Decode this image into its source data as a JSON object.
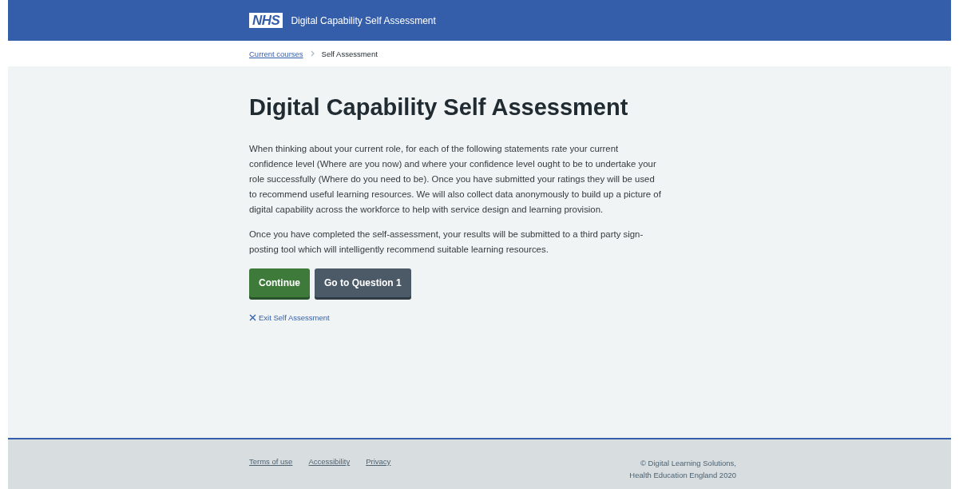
{
  "header": {
    "logo": "NHS",
    "title": "Digital Capability Self Assessment"
  },
  "breadcrumb": [
    {
      "label": "Current courses",
      "kind": "link"
    },
    {
      "label": "Self Assessment",
      "kind": "current"
    }
  ],
  "heading": "Digital Capability Self Assessment",
  "paragraphs": [
    "When thinking about your current role, for each of the following statements rate your current confidence level (Where are you now) and where your confidence level ought to be to undertake your role successfully (Where do you need to be). Once you have submitted your ratings they will be used to recommend useful learning resources. We will also collect data anonymously to build up a picture of digital capability across the workforce to help with service design and learning provision.",
    "Once you have completed the self-assessment, your results will be submitted to a third party sign-posting tool which will intelligently recommend suitable learning resources."
  ],
  "buttons": [
    {
      "label": "Continue",
      "kind": "primary"
    },
    {
      "label": "Go to Question 1",
      "kind": "secondary"
    }
  ],
  "exit_link": "Exit Self Assessment",
  "footer": {
    "links": [
      "Terms of use",
      "Accessibility",
      "Privacy"
    ],
    "copyright": [
      "© Digital Learning Solutions,",
      "Health Education England 2020"
    ]
  }
}
